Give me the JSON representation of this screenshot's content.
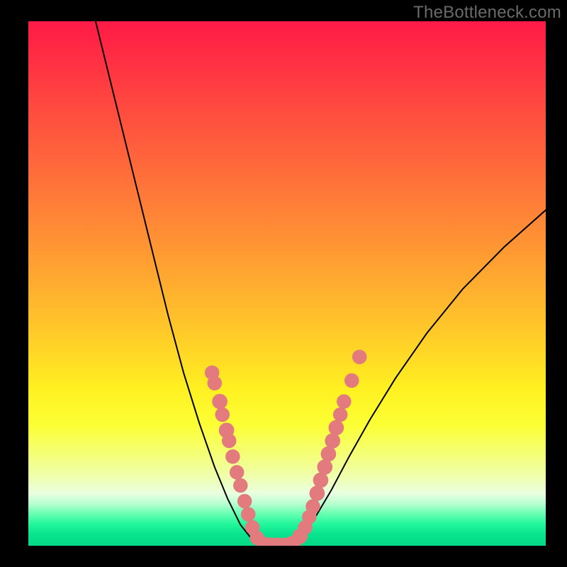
{
  "watermark": {
    "text": "TheBottleneck.com"
  },
  "chart_data": {
    "type": "line",
    "title": "",
    "xlabel": "",
    "ylabel": "",
    "xlim": [
      0,
      100
    ],
    "ylim": [
      0,
      100
    ],
    "grid": false,
    "series": [
      {
        "name": "curve-left",
        "x": [
          13.0,
          15.0,
          18.0,
          21.0,
          24.0,
          27.0,
          30.0,
          33.0,
          36.0,
          38.5,
          41.0,
          43.0,
          45.0
        ],
        "y": [
          100.0,
          92.0,
          80.0,
          68.0,
          56.0,
          44.0,
          33.0,
          23.5,
          15.0,
          9.0,
          4.0,
          1.5,
          0.2
        ],
        "color": "#000000",
        "linewidth": 1.4
      },
      {
        "name": "curve-bottom",
        "x": [
          45.0,
          46.5,
          48.0,
          49.5,
          51.0
        ],
        "y": [
          0.2,
          0.0,
          0.0,
          0.0,
          0.2
        ],
        "color": "#000000",
        "linewidth": 1.4
      },
      {
        "name": "curve-right",
        "x": [
          51.0,
          53.0,
          55.5,
          58.5,
          62.0,
          66.0,
          71.0,
          77.0,
          84.0,
          92.0,
          100.0
        ],
        "y": [
          0.2,
          2.0,
          5.5,
          10.5,
          17.0,
          24.0,
          32.0,
          40.5,
          49.0,
          57.0,
          64.0
        ],
        "color": "#000000",
        "linewidth": 1.4
      }
    ],
    "scatter": {
      "name": "data-points",
      "color": "#e27a7e",
      "points": [
        {
          "x": 35.5,
          "y": 33.0,
          "r": 4.5
        },
        {
          "x": 36.0,
          "y": 31.0,
          "r": 4.5
        },
        {
          "x": 37.0,
          "y": 27.5,
          "r": 5.0
        },
        {
          "x": 37.5,
          "y": 25.0,
          "r": 4.5
        },
        {
          "x": 38.3,
          "y": 22.0,
          "r": 5.0
        },
        {
          "x": 38.8,
          "y": 20.0,
          "r": 4.5
        },
        {
          "x": 39.5,
          "y": 17.0,
          "r": 4.5
        },
        {
          "x": 40.3,
          "y": 14.0,
          "r": 4.5
        },
        {
          "x": 41.0,
          "y": 11.5,
          "r": 4.5
        },
        {
          "x": 41.8,
          "y": 8.5,
          "r": 4.5
        },
        {
          "x": 42.5,
          "y": 6.0,
          "r": 4.5
        },
        {
          "x": 43.3,
          "y": 3.5,
          "r": 4.5
        },
        {
          "x": 44.2,
          "y": 1.5,
          "r": 4.5
        },
        {
          "x": 45.5,
          "y": 0.3,
          "r": 5.0
        },
        {
          "x": 47.0,
          "y": 0.1,
          "r": 5.0
        },
        {
          "x": 48.3,
          "y": 0.1,
          "r": 5.0
        },
        {
          "x": 49.7,
          "y": 0.1,
          "r": 5.0
        },
        {
          "x": 51.2,
          "y": 0.5,
          "r": 5.0
        },
        {
          "x": 52.5,
          "y": 1.8,
          "r": 5.0
        },
        {
          "x": 53.5,
          "y": 3.5,
          "r": 4.5
        },
        {
          "x": 54.3,
          "y": 5.5,
          "r": 4.5
        },
        {
          "x": 55.0,
          "y": 7.5,
          "r": 4.5
        },
        {
          "x": 55.8,
          "y": 10.0,
          "r": 5.0
        },
        {
          "x": 56.5,
          "y": 12.5,
          "r": 5.0
        },
        {
          "x": 57.3,
          "y": 15.0,
          "r": 5.0
        },
        {
          "x": 58.0,
          "y": 17.5,
          "r": 5.0
        },
        {
          "x": 58.8,
          "y": 20.0,
          "r": 5.0
        },
        {
          "x": 59.5,
          "y": 22.5,
          "r": 5.0
        },
        {
          "x": 60.3,
          "y": 25.0,
          "r": 4.5
        },
        {
          "x": 61.0,
          "y": 27.5,
          "r": 4.5
        },
        {
          "x": 62.5,
          "y": 31.5,
          "r": 4.5
        },
        {
          "x": 64.0,
          "y": 36.0,
          "r": 4.5
        }
      ]
    },
    "background_gradient": {
      "top_color": "#ff1a46",
      "mid_color": "#fff021",
      "bottom_color": "#04d986"
    }
  }
}
